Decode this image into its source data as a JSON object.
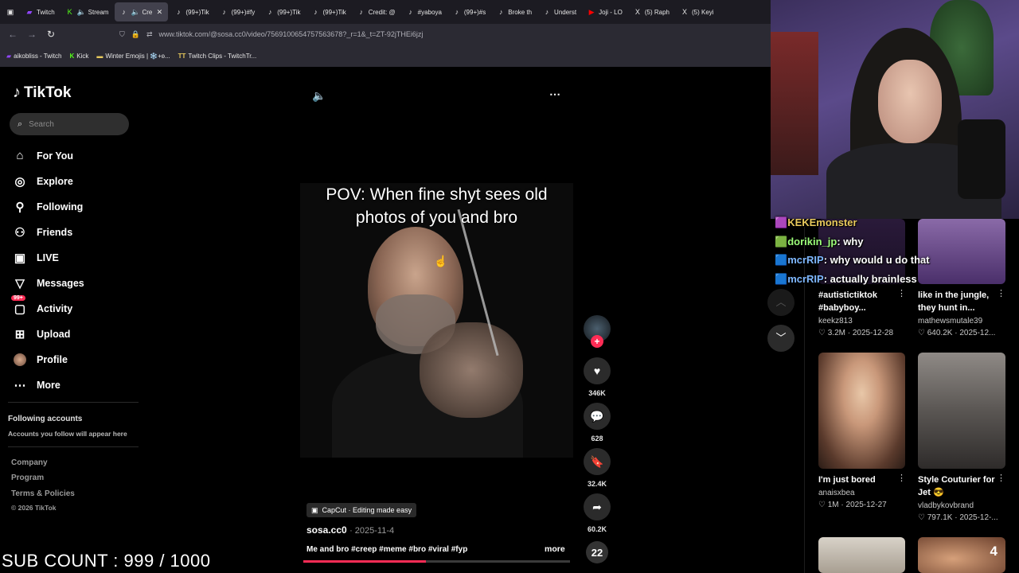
{
  "tabs": [
    {
      "icon": "twitch-icon",
      "label": "Twitch"
    },
    {
      "icon": "kick-icon",
      "label": "Stream"
    },
    {
      "icon": "tiktok-icon",
      "label": "Cre"
    },
    {
      "icon": "tiktok-icon",
      "label": "(99+)Tik"
    },
    {
      "icon": "tiktok-icon",
      "label": "(99+)#fy"
    },
    {
      "icon": "tiktok-icon",
      "label": "(99+)Tik"
    },
    {
      "icon": "tiktok-icon",
      "label": "(99+)Tik"
    },
    {
      "icon": "tiktok-icon",
      "label": "Credit: @"
    },
    {
      "icon": "tiktok-icon",
      "label": "#yaboya"
    },
    {
      "icon": "tiktok-icon",
      "label": "(99+)#s"
    },
    {
      "icon": "tiktok-icon",
      "label": "Broke th"
    },
    {
      "icon": "tiktok-icon",
      "label": "Underst"
    },
    {
      "icon": "youtube-icon",
      "label": "Joji - LO"
    },
    {
      "icon": "x-icon",
      "label": "(5) Raph"
    },
    {
      "icon": "x-icon",
      "label": "(5) Keyi"
    }
  ],
  "url": "www.tiktok.com/@sosa.cc0/video/7569100654757563678?_r=1&_t=ZT-92jTHEi6jzj",
  "bookmarks": [
    "aikobliss - Twitch",
    "Kick",
    "Winter Emojis | ❄️+ʚ...",
    "Twitch Clips - TwitchTr..."
  ],
  "tiktok": {
    "brand": "TikTok",
    "search_placeholder": "Search",
    "menu": [
      {
        "icon": "home-icon",
        "label": "For You"
      },
      {
        "icon": "compass-icon",
        "label": "Explore"
      },
      {
        "icon": "following-icon",
        "label": "Following"
      },
      {
        "icon": "friends-icon",
        "label": "Friends"
      },
      {
        "icon": "live-icon",
        "label": "LIVE"
      },
      {
        "icon": "messages-icon",
        "label": "Messages"
      },
      {
        "icon": "activity-icon",
        "label": "Activity",
        "badge": "99+"
      },
      {
        "icon": "upload-icon",
        "label": "Upload"
      },
      {
        "icon": "avatar-icon",
        "label": "Profile"
      },
      {
        "icon": "more-icon",
        "label": "More"
      }
    ],
    "following_title": "Following accounts",
    "following_sub": "Accounts you follow will appear here",
    "footer": [
      "Company",
      "Program",
      "Terms & Policies"
    ],
    "copyright": "© 2026 TikTok"
  },
  "video": {
    "caption_overlay": "POV: When fine shyt sees old photos of you and bro",
    "capcut": "CapCut · Editing made easy",
    "author": "sosa.cc0",
    "date": "2025-11-4",
    "description": "Me and bro #creep #meme #bro #viral #fyp",
    "more": "more",
    "progress": 0.46
  },
  "actions": {
    "likes": "346K",
    "comments": "628",
    "saves": "32.4K",
    "shares": "60.2K",
    "music_number": "22"
  },
  "recommendations": [
    {
      "title": "#autistictiktok #babyboy...",
      "author": "keekz813",
      "views": "3.2M",
      "date": "2025-12-28"
    },
    {
      "title": "like in the jungle, they hunt in...",
      "author": "mathewsmutale39",
      "views": "640.2K",
      "date": "2025-12..."
    },
    {
      "title": "I'm just bored",
      "author": "anaisxbea",
      "views": "1M",
      "date": "2025-12-27"
    },
    {
      "title": "Style Couturier for Jet 😎",
      "author": "vladbykovbrand",
      "views": "797.1K",
      "date": "2025-12-..."
    }
  ],
  "chat": [
    {
      "user": "KEKEmonster",
      "msg": ""
    },
    {
      "user": "dorikin_jp",
      "msg": ": why"
    },
    {
      "user": "mcrRIP",
      "msg": ": why would u do that"
    },
    {
      "user": "mcrRIP",
      "msg": ": actually brainless"
    }
  ],
  "sub_count": "SUB COUNT : 999 / 1000",
  "thumb_badge": "4"
}
